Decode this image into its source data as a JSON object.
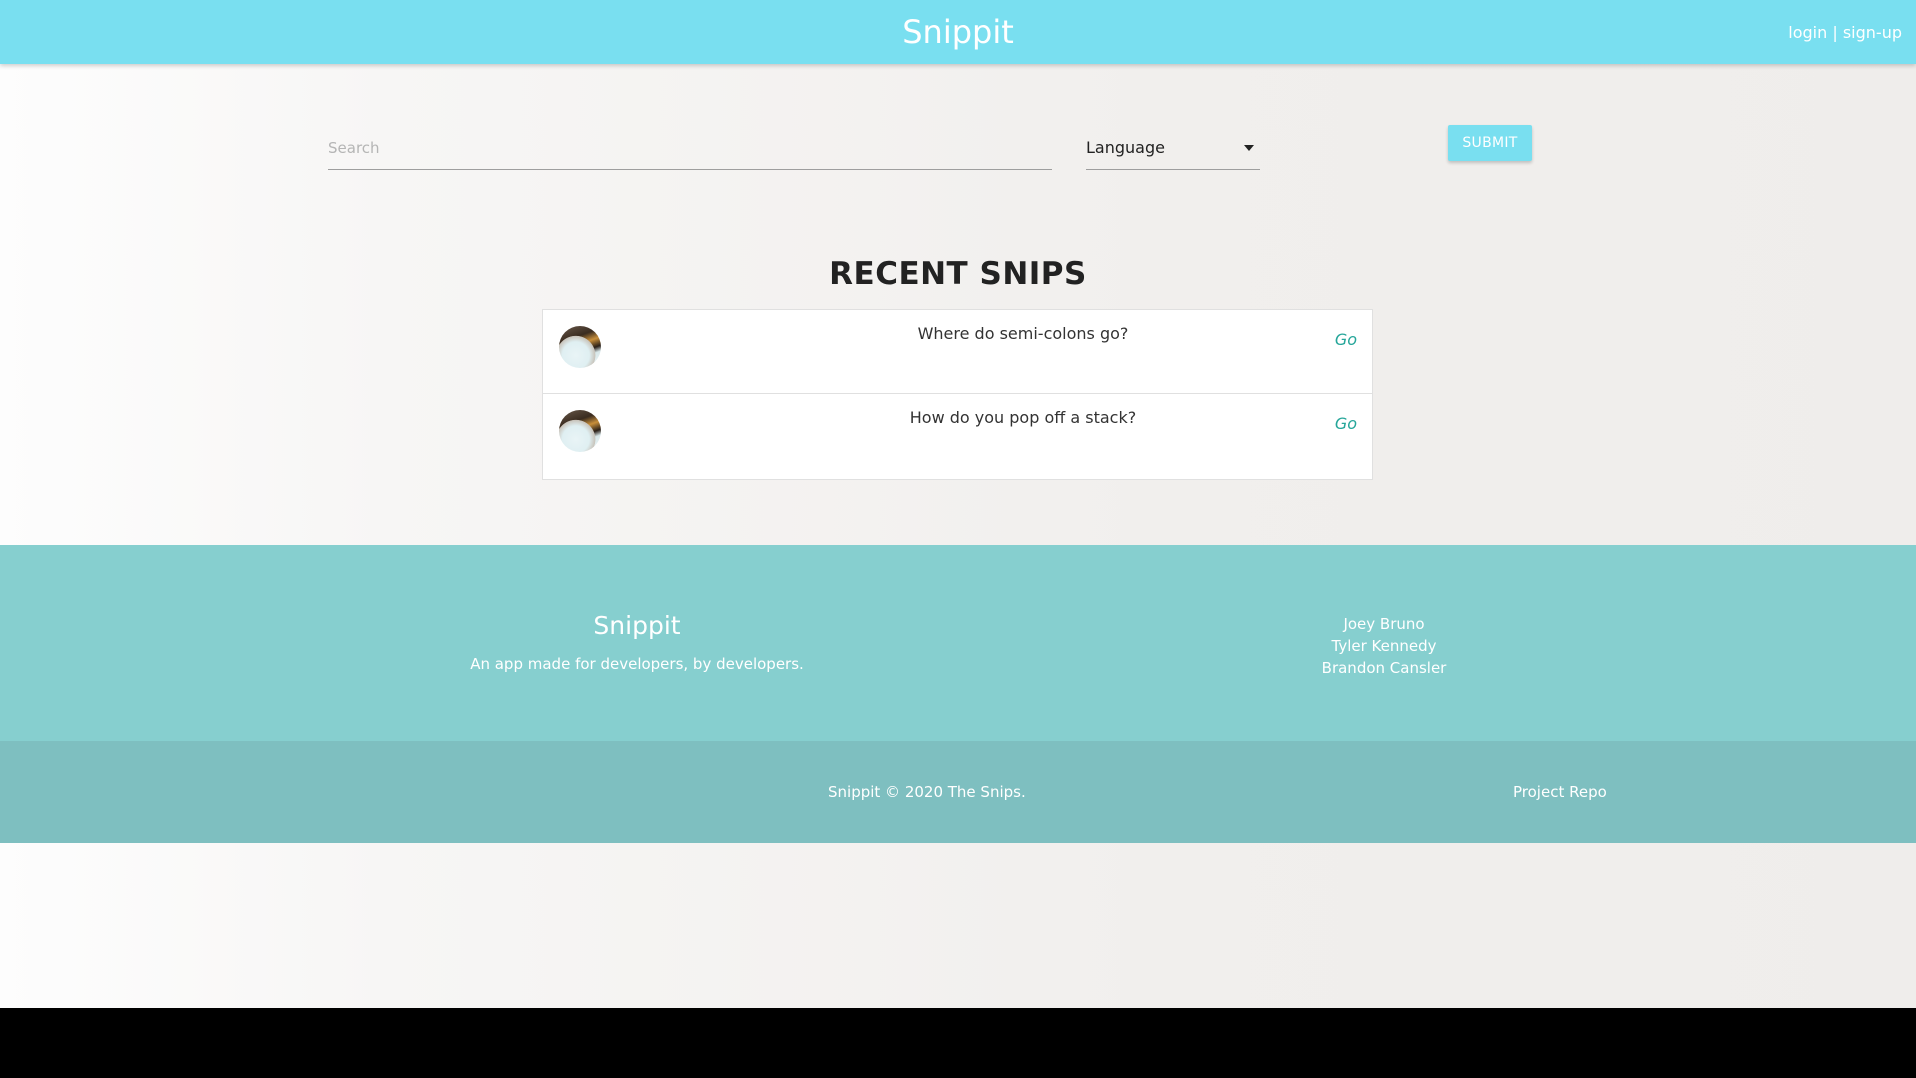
{
  "navbar": {
    "brand": "Snippit",
    "login_label": "login",
    "separator": "|",
    "signup_label": "sign-up",
    "color": "#79dff0"
  },
  "search": {
    "placeholder": "Search",
    "value": "",
    "language_select": "Language",
    "submit_label": "SUBMIT"
  },
  "recent": {
    "title": "RECENT SNIPS",
    "items": [
      {
        "title": "Where do semi-colons go?",
        "link_label": "Go",
        "avatar_icon": "user-avatar-icon"
      },
      {
        "title": "How do you pop off a stack?",
        "link_label": "Go",
        "avatar_icon": "user-avatar-icon"
      }
    ]
  },
  "footer": {
    "brand": "Snippit",
    "tagline": "An app made for developers, by developers.",
    "team": [
      "Joey Bruno",
      "Tyler Kennedy",
      "Brandon Cansler"
    ],
    "copyright": "Snippit © 2020 The Snips.",
    "repo_link": "Project Repo",
    "color": "#86cfcf",
    "copy_color": "#7ebfc0"
  }
}
